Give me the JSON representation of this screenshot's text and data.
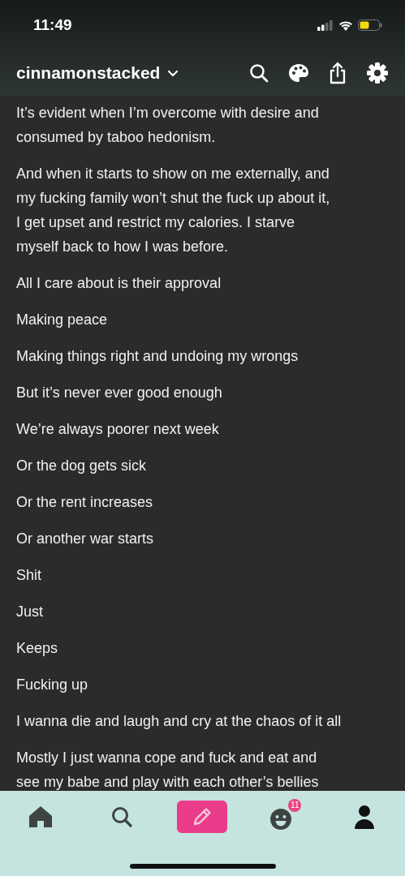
{
  "status_bar": {
    "time": "11:49"
  },
  "header": {
    "blog_name": "cinnamonstacked"
  },
  "post": {
    "paragraphs": [
      {
        "lines": [
          "It’s evident when I’m overcome with desire and",
          "consumed by taboo hedonism."
        ]
      },
      {
        "lines": [
          "And when it starts to show on me externally, and",
          "my fucking family won’t shut the fuck up about it,",
          "I get upset and restrict my calories. I starve",
          "myself back to how I was before."
        ]
      },
      {
        "lines": [
          "All I care about is their approval"
        ]
      },
      {
        "lines": [
          "Making peace"
        ]
      },
      {
        "lines": [
          "Making things right and undoing my wrongs"
        ]
      },
      {
        "lines": [
          "But it’s never ever good enough"
        ]
      },
      {
        "lines": [
          "We’re always poorer next week"
        ]
      },
      {
        "lines": [
          "Or the dog gets sick"
        ]
      },
      {
        "lines": [
          "Or the rent increases"
        ]
      },
      {
        "lines": [
          "Or another war starts"
        ]
      },
      {
        "lines": [
          "Shit"
        ]
      },
      {
        "lines": [
          "Just"
        ]
      },
      {
        "lines": [
          "Keeps"
        ]
      },
      {
        "lines": [
          "Fucking up"
        ]
      },
      {
        "lines": [
          "I wanna die and laugh and cry at the chaos of it all"
        ]
      },
      {
        "lines": [
          "Mostly I just wanna cope and fuck and eat and",
          "see my babe and play with each other’s bellies"
        ]
      }
    ]
  },
  "tab_bar": {
    "items": [
      {
        "kind": "home"
      },
      {
        "kind": "search"
      },
      {
        "kind": "compose"
      },
      {
        "kind": "activity",
        "badge": "11"
      },
      {
        "kind": "account"
      }
    ]
  }
}
